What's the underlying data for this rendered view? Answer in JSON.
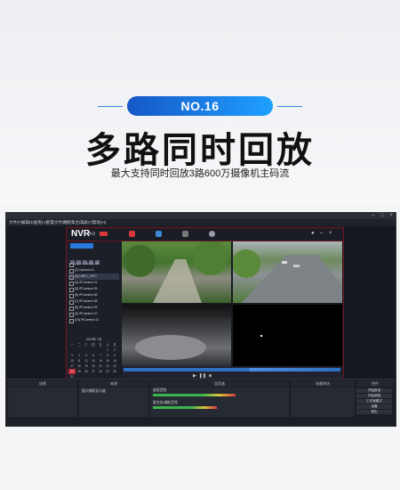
{
  "banner": {
    "badge": "NO.16",
    "headline": "多路同时回放",
    "subtitle": "最大支持同时回放3路600万摄像机主码流"
  },
  "obs": {
    "menu": [
      "文件(F)",
      "编辑(E)",
      "查看(V)",
      "配置文件(P)",
      "场景集合(S)",
      "工具(T)",
      "帮助(H)"
    ],
    "panels": {
      "scenes": "场景",
      "sources": "来源",
      "mixer": "混音器",
      "transitions": "场景转场",
      "controls": "控件"
    },
    "mixer_tracks": [
      {
        "name": "桌面音频",
        "level": 0.62
      },
      {
        "name": "麦克风/辅助音频",
        "level": 0.48
      }
    ],
    "control_buttons": [
      "开始推流",
      "开始录制",
      "工作室模式",
      "设置",
      "退出"
    ],
    "source_item": "窗口捕获显示器"
  },
  "nvr": {
    "logo": "NVR",
    "version": "4.0",
    "cameras": [
      "[1] 172.16.16.174",
      "[2] Camera 01",
      "[3] L98T1_T6T7",
      "[4] IPCamera 01",
      "[5] IPCamera 05",
      "[6] IPCamera 06",
      "[7] IPCamera 08",
      "[8] IPCamera 09",
      "[9] IPCamera 10",
      "[10] IPCamera 11"
    ],
    "selected_camera_index": 2,
    "calendar": {
      "month": "2023年 7月",
      "weekdays": [
        "一",
        "二",
        "三",
        "四",
        "五",
        "六",
        "日"
      ],
      "days": [
        "",
        "",
        "",
        "",
        "",
        "1",
        "2",
        "3",
        "4",
        "5",
        "6",
        "7",
        "8",
        "9",
        "10",
        "11",
        "12",
        "13",
        "14",
        "15",
        "16",
        "17",
        "18",
        "19",
        "20",
        "21",
        "22",
        "23",
        "24",
        "25",
        "26",
        "27",
        "28",
        "29",
        "30",
        "31"
      ],
      "today": "24"
    }
  },
  "colors": {
    "accent_blue": "#1e7be8",
    "nvr_red": "#c02a3a",
    "background": "#f4f5f7"
  }
}
